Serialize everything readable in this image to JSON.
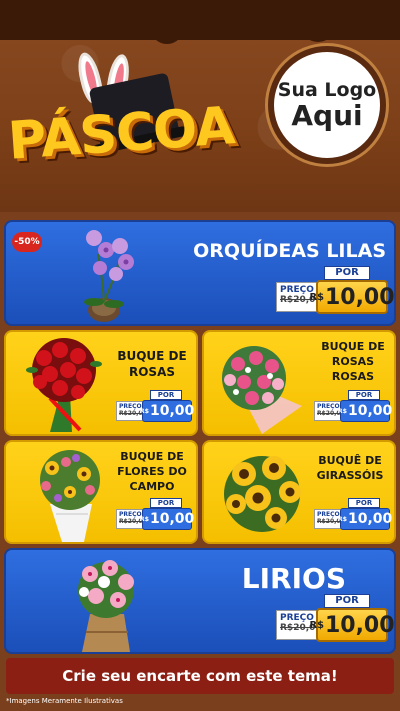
{
  "header": {
    "title": "PÁSCOA",
    "logo_line1": "Sua Logo",
    "logo_line2": "Aqui"
  },
  "products": [
    {
      "name": "ORQUÍDEAS LILAS",
      "badge": "-50%",
      "por": "POR",
      "preco_label": "PREÇO",
      "old_price": "R$20,00",
      "currency": "R$",
      "price": "10,00"
    },
    {
      "name": "BUQUE DE ROSAS",
      "por": "POR",
      "preco_label": "PREÇO",
      "old_price": "R$20,00",
      "currency": "R$",
      "price": "10,00"
    },
    {
      "name": "BUQUE DE ROSAS ROSAS",
      "por": "POR",
      "preco_label": "PREÇO",
      "old_price": "R$20,00",
      "currency": "R$",
      "price": "10,00"
    },
    {
      "name": "BUQUE DE FLORES DO CAMPO",
      "por": "POR",
      "preco_label": "PREÇO",
      "old_price": "R$20,00",
      "currency": "R$",
      "price": "10,00"
    },
    {
      "name": "BUQUÊ DE GIRASSÓIS",
      "por": "POR",
      "preco_label": "PREÇO",
      "old_price": "R$20,00",
      "currency": "R$",
      "price": "10,00"
    },
    {
      "name": "LIRIOS",
      "por": "POR",
      "preco_label": "PREÇO",
      "old_price": "R$20,00",
      "currency": "R$",
      "price": "10,00"
    }
  ],
  "footer": {
    "cta": "Crie seu encarte com este tema!",
    "disclaimer": "*Imagens Meramente Ilustrativas"
  },
  "colors": {
    "blue_panel": "#2f6ee0",
    "yellow_panel": "#ffd21a",
    "chocolate": "#7a3f1c",
    "footer_red": "#8c1f14"
  }
}
